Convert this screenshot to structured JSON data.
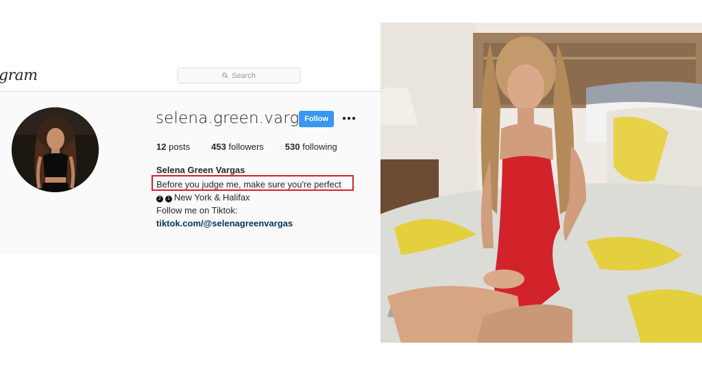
{
  "header": {
    "logo_text": "gram",
    "search_placeholder": "Search"
  },
  "profile": {
    "username": "selena.green.vargas",
    "follow_label": "Follow",
    "more_label": "•••",
    "stats": {
      "posts_count": "12",
      "posts_label": "posts",
      "followers_count": "453",
      "followers_label": "followers",
      "following_count": "530",
      "following_label": "following"
    },
    "full_name": "Selena Green Vargas",
    "bio": {
      "quote": "Before you judge me, make sure you're perfect",
      "badge_1": "2",
      "badge_2": "1",
      "location": "New York & Halifax",
      "follow_line": "Follow me on Tiktok:",
      "link": "tiktok.com/@selenagreenvargas"
    }
  },
  "colors": {
    "follow_button": "#3897f0",
    "highlight_box": "#d0202a",
    "link": "#003569"
  },
  "icons": [
    "search-icon",
    "more-options-icon"
  ]
}
